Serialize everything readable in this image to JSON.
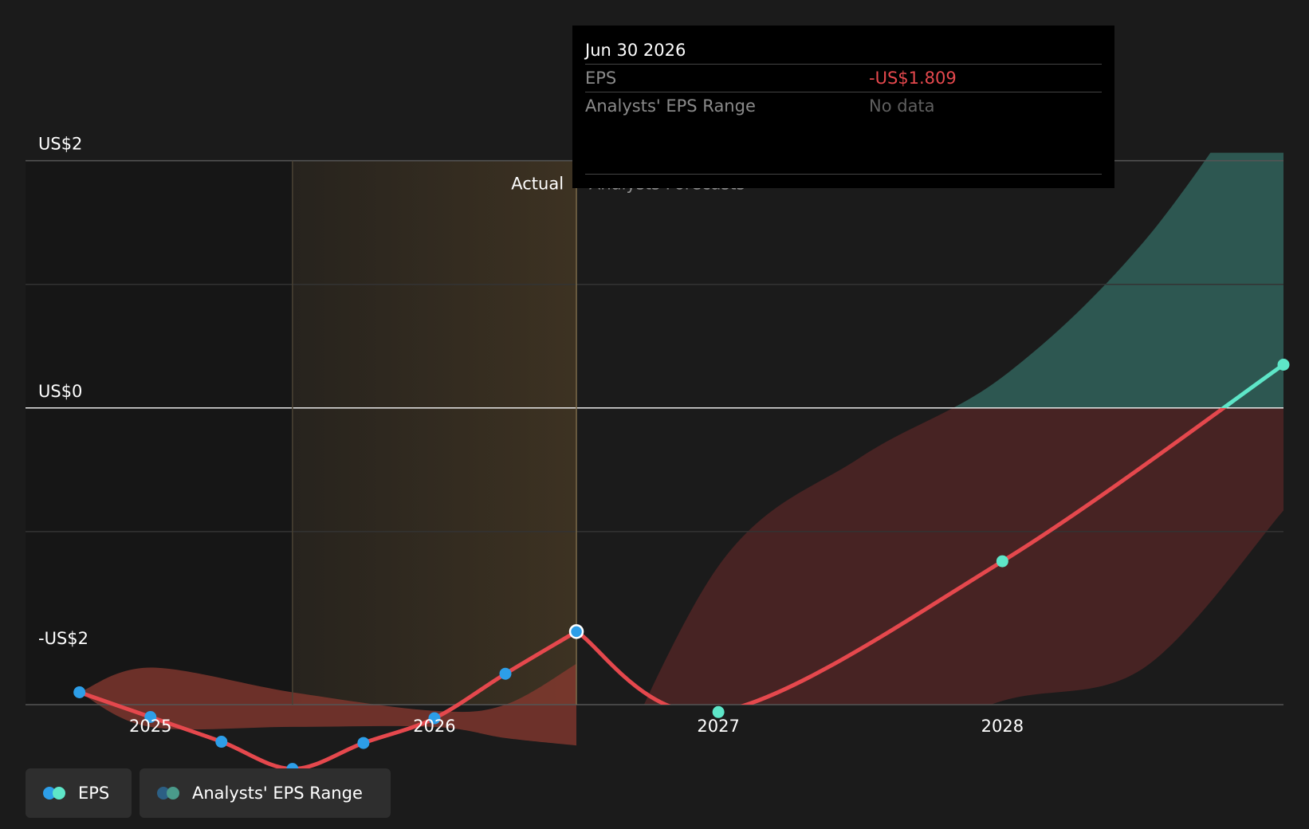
{
  "colors": {
    "background": "#1b1b1b",
    "eps_actual_point": "#2d9ee8",
    "eps_forecast_point": "#5ee6c8",
    "eps_line_negative": "#e5484d",
    "eps_line_positive": "#5ee6c8",
    "range_negative": "#6b2a2a",
    "range_positive": "#2e5b54",
    "actual_highlight": "#3d3222"
  },
  "tooltip": {
    "date": "Jun 30 2026",
    "rows": [
      {
        "label": "EPS",
        "value": "-US$1.809"
      },
      {
        "label": "Analysts' EPS Range",
        "value": "No data"
      }
    ]
  },
  "legend": {
    "items": [
      {
        "label": "EPS",
        "dot_colors": [
          "#2d9ee8",
          "#5ee6c8"
        ]
      },
      {
        "label": "Analysts' EPS Range",
        "dot_colors": [
          "#2c5f84",
          "#4a9a8a"
        ]
      }
    ]
  },
  "chart_data": {
    "type": "line",
    "y_ticks": [
      {
        "value": 2,
        "label": "US$2"
      },
      {
        "value": 0,
        "label": "US$0"
      },
      {
        "value": -2,
        "label": "-US$2"
      }
    ],
    "x_ticks": [
      {
        "value": 2025.0,
        "label": "2025"
      },
      {
        "value": 2026.0,
        "label": "2026"
      },
      {
        "value": 2027.0,
        "label": "2027"
      },
      {
        "value": 2028.0,
        "label": "2028"
      }
    ],
    "xlim": [
      2024.56,
      2028.99
    ],
    "ylim": [
      -2.4,
      3.3
    ],
    "divider_x": 2026.5,
    "highlight_start_x": 2025.5,
    "region_labels": {
      "actual": "Actual",
      "forecast": "Analysts Forecasts"
    },
    "series": [
      {
        "name": "EPS",
        "actual": [
          {
            "x": 2024.75,
            "y": -2.3
          },
          {
            "x": 2025.0,
            "y": -2.5
          },
          {
            "x": 2025.25,
            "y": -2.7
          },
          {
            "x": 2025.5,
            "y": -2.92
          },
          {
            "x": 2025.75,
            "y": -2.71
          },
          {
            "x": 2026.0,
            "y": -2.51
          },
          {
            "x": 2026.25,
            "y": -2.15
          },
          {
            "x": 2026.5,
            "y": -1.809
          }
        ],
        "forecast": [
          {
            "x": 2026.5,
            "y": -1.809
          },
          {
            "x": 2027.0,
            "y": -2.46
          },
          {
            "x": 2028.0,
            "y": -1.24
          },
          {
            "x": 2028.99,
            "y": 0.35
          }
        ]
      }
    ],
    "range_actual": {
      "upper": [
        {
          "x": 2024.75,
          "y": -2.3
        },
        {
          "x": 2025.0,
          "y": -2.1
        },
        {
          "x": 2025.5,
          "y": -2.3
        },
        {
          "x": 2026.0,
          "y": -2.45
        },
        {
          "x": 2026.25,
          "y": -2.4
        },
        {
          "x": 2026.5,
          "y": -2.07
        }
      ],
      "lower": [
        {
          "x": 2026.5,
          "y": -2.73
        },
        {
          "x": 2026.25,
          "y": -2.67
        },
        {
          "x": 2026.0,
          "y": -2.58
        },
        {
          "x": 2025.5,
          "y": -2.58
        },
        {
          "x": 2025.0,
          "y": -2.58
        },
        {
          "x": 2024.75,
          "y": -2.3
        }
      ]
    },
    "range_forecast": {
      "upper": [
        {
          "x": 2026.5,
          "y": -3.6
        },
        {
          "x": 2027.0,
          "y": -1.28
        },
        {
          "x": 2027.5,
          "y": -0.4
        },
        {
          "x": 2028.0,
          "y": 0.25
        },
        {
          "x": 2028.5,
          "y": 1.35
        },
        {
          "x": 2028.99,
          "y": 2.93
        }
      ],
      "lower": [
        {
          "x": 2028.99,
          "y": -0.83
        },
        {
          "x": 2028.5,
          "y": -2.1
        },
        {
          "x": 2028.0,
          "y": -2.37
        },
        {
          "x": 2027.5,
          "y": -2.8
        },
        {
          "x": 2027.0,
          "y": -3.1
        },
        {
          "x": 2026.5,
          "y": -3.6
        }
      ]
    }
  }
}
